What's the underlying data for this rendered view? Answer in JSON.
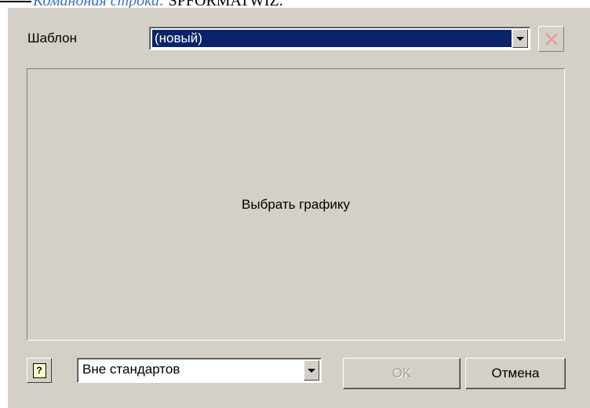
{
  "caption": {
    "label": "Командная строка:",
    "command": "SPFORMATWIZ."
  },
  "template": {
    "label": "Шаблон",
    "value": "(новый)"
  },
  "preview": {
    "text": "Выбрать графику"
  },
  "standard": {
    "value": "Вне стандартов"
  },
  "buttons": {
    "ok": "OK",
    "cancel": "Отмена",
    "help": "?"
  },
  "colors": {
    "dialog_bg": "#d4d0c8",
    "selection": "#0a246a",
    "delete_x": "#e59a9a",
    "caption_label": "#3a74b6"
  },
  "icons": [
    "chevron-down-icon",
    "close-icon",
    "help-icon"
  ]
}
